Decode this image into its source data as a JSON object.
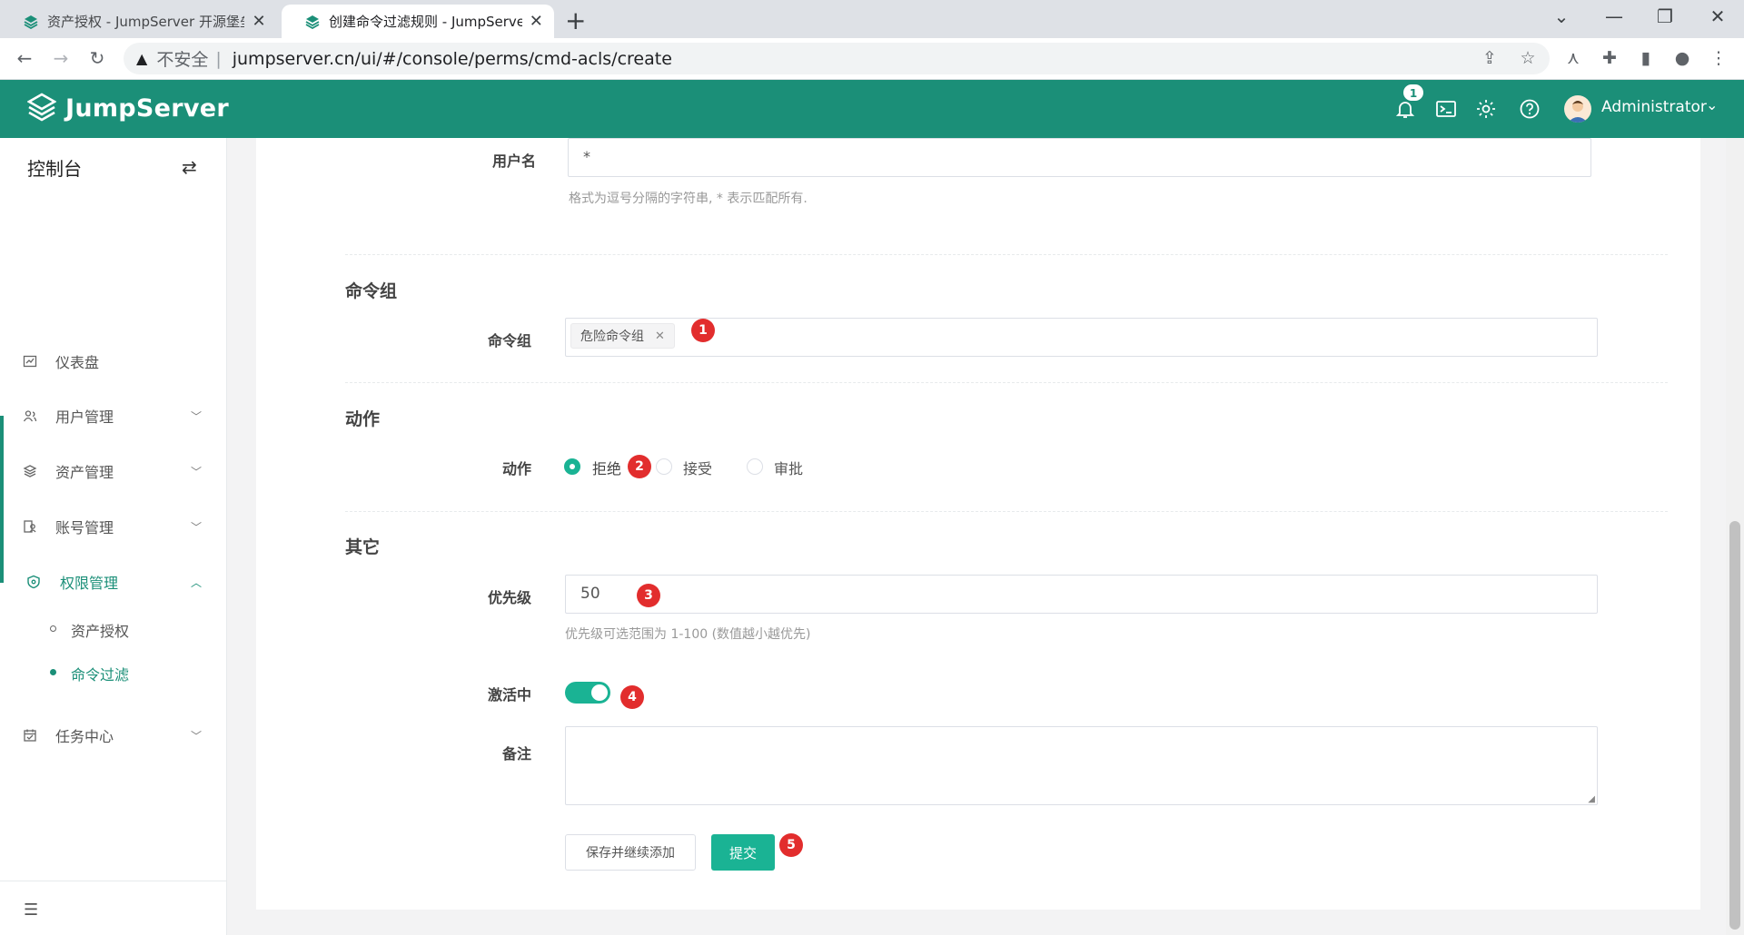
{
  "browser": {
    "tabs": [
      {
        "title": "资产授权 - JumpServer 开源堡垒",
        "active": false
      },
      {
        "title": "创建命令过滤规则 - JumpServer",
        "active": true
      }
    ],
    "address": {
      "security_label": "不安全",
      "url": "jumpserver.cn/ui/#/console/perms/cmd-acls/create"
    }
  },
  "header": {
    "logo_text": "JumpServer",
    "notification_count": "1",
    "user_name": "Administrator",
    "brand_color": "#1b8f78"
  },
  "sidebar": {
    "title": "控制台",
    "items": [
      {
        "label": "仪表盘",
        "icon": "dashboard-icon"
      },
      {
        "label": "用户管理",
        "icon": "users-icon"
      },
      {
        "label": "资产管理",
        "icon": "layers-icon"
      },
      {
        "label": "账号管理",
        "icon": "account-icon"
      },
      {
        "label": "权限管理",
        "icon": "shield-icon"
      },
      {
        "label": "任务中心",
        "icon": "calendar-icon"
      }
    ],
    "sub_items": [
      {
        "label": "资产授权",
        "active": false
      },
      {
        "label": "命令过滤",
        "active": true
      }
    ]
  },
  "form": {
    "username": {
      "label": "用户名",
      "value": "*",
      "hint": "格式为逗号分隔的字符串, * 表示匹配所有."
    },
    "cmd_group_section": "命令组",
    "cmd_group": {
      "label": "命令组",
      "tags": [
        "危险命令组"
      ]
    },
    "action_section": "动作",
    "action": {
      "label": "动作",
      "options": [
        "拒绝",
        "接受",
        "审批"
      ],
      "selected": "拒绝"
    },
    "other_section": "其它",
    "priority": {
      "label": "优先级",
      "value": "50",
      "hint": "优先级可选范围为 1-100 (数值越小越优先)"
    },
    "active": {
      "label": "激活中",
      "on": true
    },
    "comment": {
      "label": "备注",
      "value": ""
    },
    "buttons": {
      "save_continue": "保存并继续添加",
      "submit": "提交"
    }
  },
  "markers": [
    "1",
    "2",
    "3",
    "4",
    "5"
  ],
  "colors": {
    "accent": "#1ab394",
    "marker": "#e22d2d"
  }
}
